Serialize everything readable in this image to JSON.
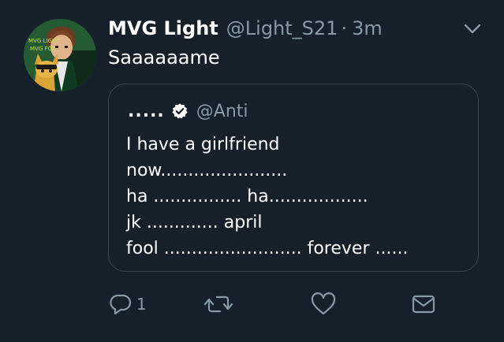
{
  "tweet": {
    "display_name": "MVG Light",
    "handle": "@Light_S21",
    "separator": "·",
    "time": "3m",
    "text": "Saaaaaame",
    "avatar_text_line1": "MVG LIGHT",
    "avatar_text_line2": "MVG FOX"
  },
  "quote": {
    "display_name": ".....",
    "handle": "@Anti",
    "verified": true,
    "body": "I have a girlfriend\nnow.......................\nha ................ ha..................\njk ............. april\nfool ......................... forever ......"
  },
  "actions": {
    "reply_count": "1",
    "icons": [
      "reply-icon",
      "retweet-icon",
      "like-icon",
      "message-icon"
    ]
  },
  "colors": {
    "background": "#15202b",
    "border": "#38444d",
    "secondary_text": "#8899a6",
    "primary_text": "#ffffff"
  }
}
